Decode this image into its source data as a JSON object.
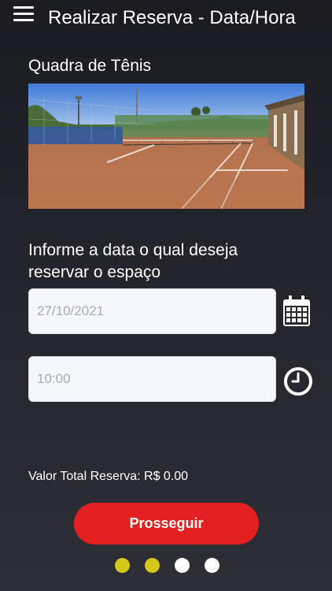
{
  "header": {
    "title": "Realizar Reserva - Data/Hora",
    "menu_icon": "hamburger-menu-icon"
  },
  "space": {
    "name": "Quadra de Tênis",
    "image": "tennis-court-photo"
  },
  "form": {
    "prompt": "Informe a data o qual deseja reservar o espaço",
    "date": {
      "value": "27/10/2021",
      "icon": "calendar-icon"
    },
    "time": {
      "value": "10:00",
      "icon": "clock-icon"
    }
  },
  "summary": {
    "total_label": "Valor Total Reserva: R$ 0.00"
  },
  "actions": {
    "proceed_label": "Prosseguir"
  },
  "steps": {
    "total": 4,
    "completed": 2,
    "active_color": "#d4c91a",
    "inactive_color": "#ffffff"
  },
  "colors": {
    "accent": "#e32020",
    "background": "#24242c"
  }
}
